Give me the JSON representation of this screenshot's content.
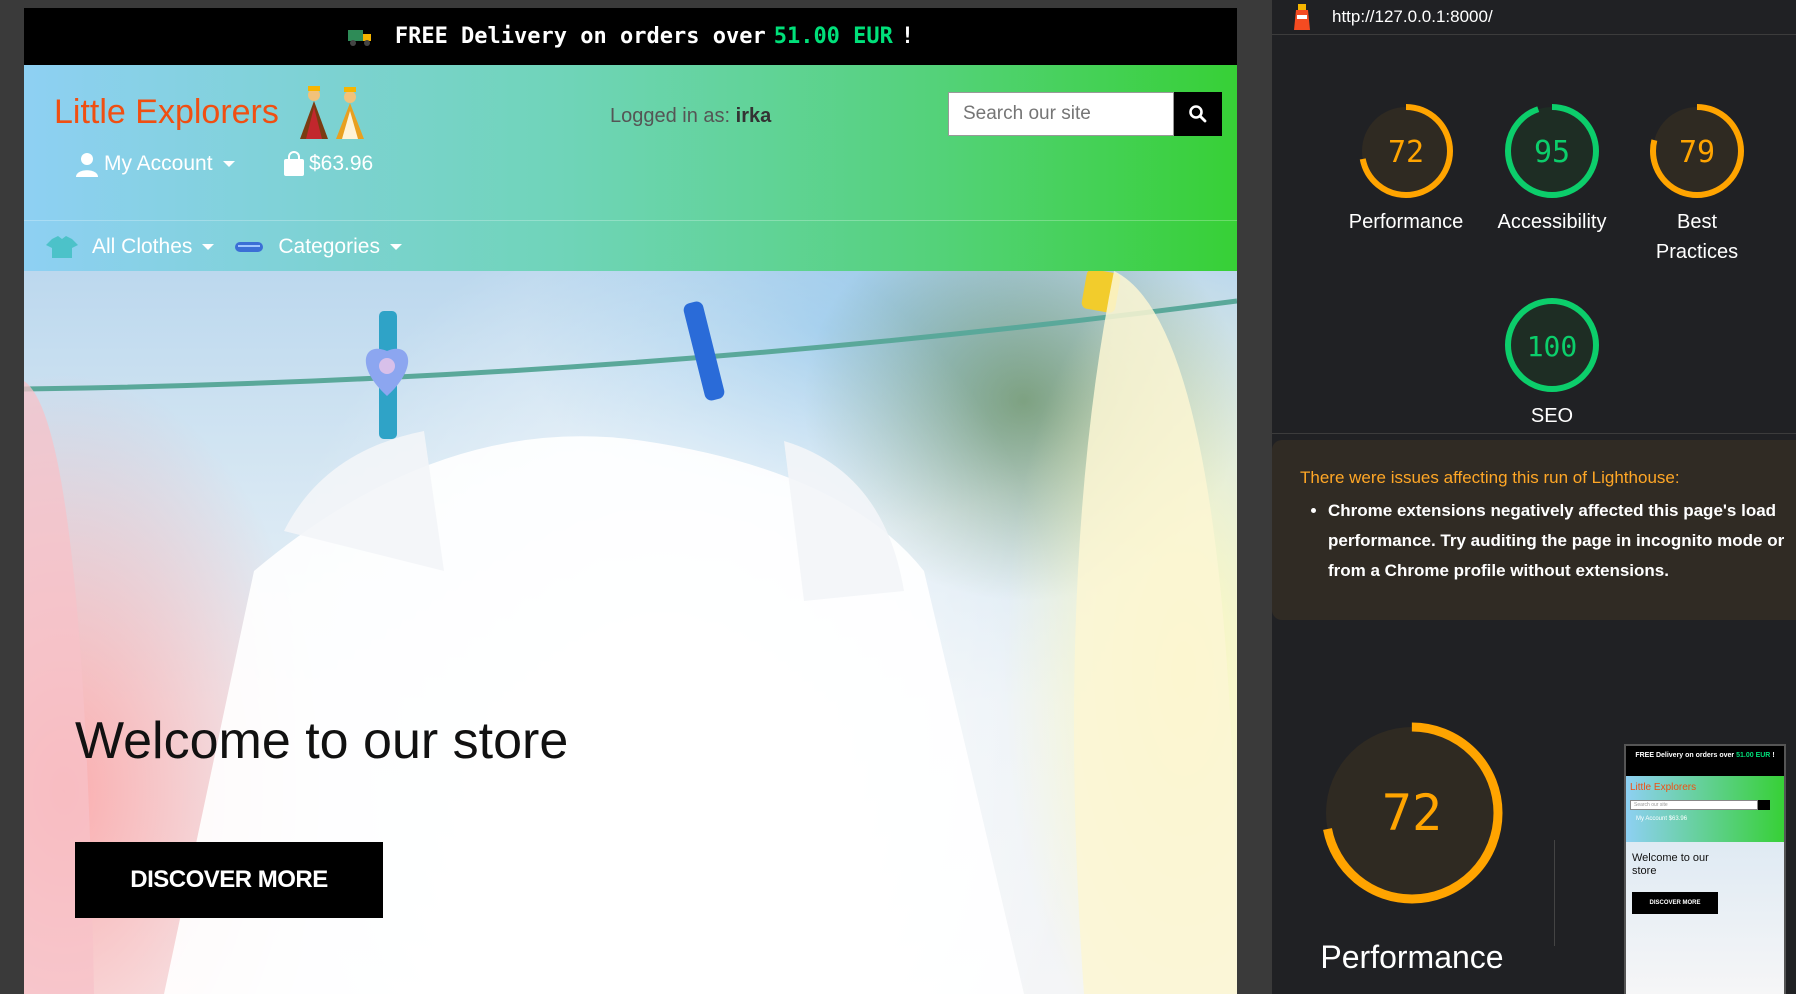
{
  "announcement": {
    "prefix": "FREE Delivery on orders over",
    "amount": "51.00 EUR",
    "suffix": "!",
    "truck_icon": "truck-icon"
  },
  "header": {
    "brand": "Little Explorers",
    "logged_in_label": "Logged in as:",
    "username": "irka",
    "search_placeholder": "Search our site",
    "account_label": "My Account",
    "cart_total": "$63.96"
  },
  "nav": {
    "items": [
      {
        "label": "All Clothes",
        "icon": "shirt-icon"
      },
      {
        "label": "Categories",
        "icon": "category-icon"
      }
    ]
  },
  "hero": {
    "title": "Welcome to our store",
    "button": "DISCOVER MORE"
  },
  "lighthouse": {
    "url": "http://127.0.0.1:8000/",
    "scores": [
      {
        "label": "Performance",
        "value": "72"
      },
      {
        "label": "Accessibility",
        "value": "95"
      },
      {
        "label": "Best Practices",
        "value": "79"
      },
      {
        "label": "SEO",
        "value": "100"
      }
    ],
    "warning_title": "There were issues affecting this run of Lighthouse:",
    "warning_items": [
      "Chrome extensions negatively affected this page's load performance. Try auditing the page in incognito mode or from a Chrome profile without extensions."
    ],
    "main_score": "72",
    "main_label": "Performance",
    "thumbnail": {
      "topbar_prefix": "FREE Delivery on orders over",
      "topbar_amount": "51.00 EUR",
      "topbar_suffix": "!",
      "brand": "Little Explorers",
      "search_placeholder": "Search our site",
      "account": "My Account",
      "cart": "$63.96",
      "title": "Welcome to our store",
      "button": "DISCOVER MORE"
    }
  },
  "colors": {
    "pass": "#0cce6b",
    "average": "#ffa400",
    "brand": "#f04f12",
    "promo_amount": "#00e07a"
  }
}
